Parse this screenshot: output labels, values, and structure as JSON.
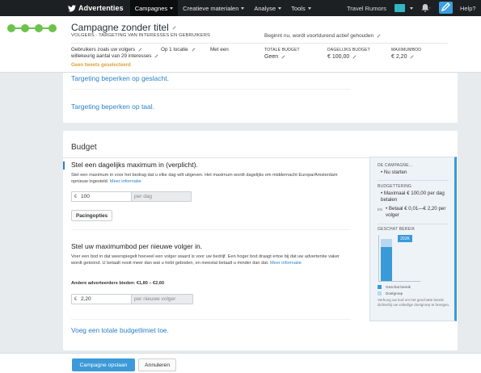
{
  "nav": {
    "brand": "Advertenties",
    "items": [
      {
        "label": "Campagnes",
        "active": true
      },
      {
        "label": "Creatieve materialen",
        "active": false
      },
      {
        "label": "Analyse",
        "active": false
      },
      {
        "label": "Tools",
        "active": false
      }
    ],
    "account": "Travel Rumors",
    "help": "Help?",
    "colors": {
      "bar": "#1c2022",
      "accent": "#3b9ee0"
    }
  },
  "header": {
    "title": "Campagne zonder titel",
    "subtitle": "VOLGERS · TARGETING VAN INTERESSES EN GEBRUIKERS",
    "start": "Beginnt nu, wordt voortdurend actief gehouden",
    "targeting_users": "Gebruikers zoals uw volgers",
    "targeting_location": "Op 1 locatie",
    "targeting_with": "Met een",
    "targeting_interests": "willekeurig aantal van 29 interesses",
    "warning": "Geen tweets geselecteerd",
    "total_budget_label": "TOTALE BUDGET",
    "total_budget_value": "Geen",
    "daily_budget_label": "DAGELIJKS BUDGET",
    "daily_budget_value": "€ 100,00",
    "max_bid_label": "MAXIMUMBOD",
    "max_bid_value": "€ 2,20"
  },
  "targeting": {
    "gender_link": "Targeting beperken op geslacht.",
    "language_link": "Targeting beperken op taal."
  },
  "budget": {
    "heading": "Budget",
    "daily_title": "Stel een dagelijks maximum in (verplicht).",
    "daily_help": "Stel een maximum in voor het bedrag dat u elke dag wilt uitgeven. Het maximum wordt dagelijks om middernacht Europa/Amsterdam opnieuw ingesteld.",
    "daily_more": "Meer informatie",
    "currency": "€",
    "daily_value": "100",
    "daily_unit": "per dag",
    "pacing_button": "Pacingopties",
    "bid_title": "Stel uw maximumbod per nieuwe volger in.",
    "bid_help": "Voer een bod in dat weerspiegelt hoeveel een volger waard is voor uw bedrijf. Een hoger bod draagt ertoe bij dat uw advertentie vaker wordt getoond. U betaalt nooit meer dan wat u hebt geboden, en meestal betaalt u minder dan dat.",
    "bid_more": "Meer informatie",
    "other_bids": "Andere adverteerders bieden: €1,80 – €2,60",
    "bid_value": "2,20",
    "bid_unit": "per nieuwe volger",
    "total_link": "Voeg een totale budgetlimiet toe."
  },
  "summary": {
    "campaign_label": "DE CAMPAGNE...",
    "campaign_value": "• Nu starten",
    "budget_label": "BUDGETTERING",
    "budget_max": "• Maximaal € 100,00 per dag betalen",
    "budget_pre": "EN",
    "budget_pay": "• Betaal € 0,01—€ 2,20 per volger",
    "reach_label": "GESCHAT BEREIK",
    "reach_value": "202K",
    "reach_fill": 0.8,
    "legend_reach": "Geschat bereik",
    "legend_target": "Doelgroep",
    "note": "Verhoog uw bod om het geschatte bereik dichterbij uw volledige doelgroep te brengen.",
    "colors": {
      "reach": "#3a9ad9",
      "target": "#b6d8f1"
    }
  },
  "footer": {
    "save": "Campagne opslaan",
    "cancel": "Annuleren"
  }
}
